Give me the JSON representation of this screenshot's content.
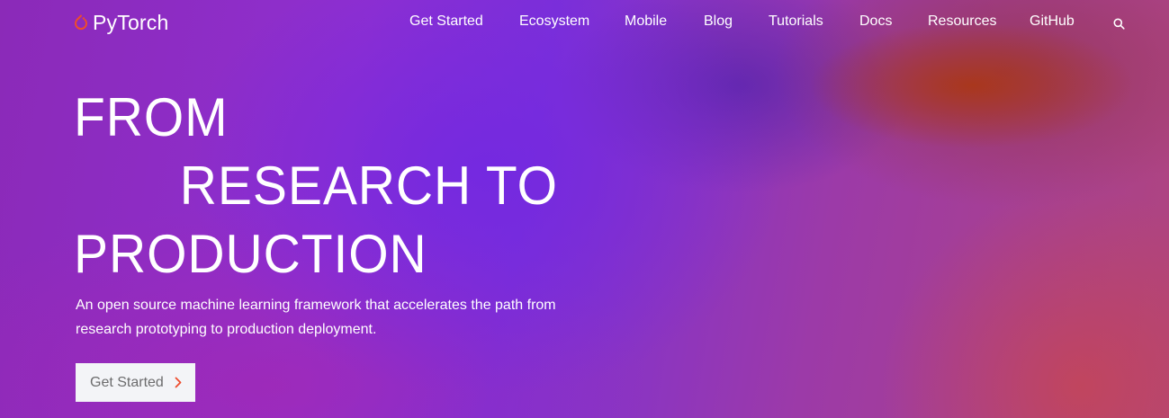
{
  "brand": {
    "name": "PyTorch",
    "logo_icon": "pytorch-flame-icon",
    "accent_color": "#ee4c2c"
  },
  "nav": {
    "items": [
      {
        "label": "Get Started"
      },
      {
        "label": "Ecosystem"
      },
      {
        "label": "Mobile"
      },
      {
        "label": "Blog"
      },
      {
        "label": "Tutorials"
      },
      {
        "label": "Docs"
      },
      {
        "label": "Resources"
      },
      {
        "label": "GitHub"
      }
    ],
    "search_icon": "search-icon"
  },
  "hero": {
    "title_lines": [
      "FROM",
      "RESEARCH TO",
      "PRODUCTION"
    ],
    "description": "An open source machine learning framework that accelerates the path from research prototyping to production deployment.",
    "cta_label": "Get Started",
    "cta_icon": "chevron-right-icon"
  }
}
